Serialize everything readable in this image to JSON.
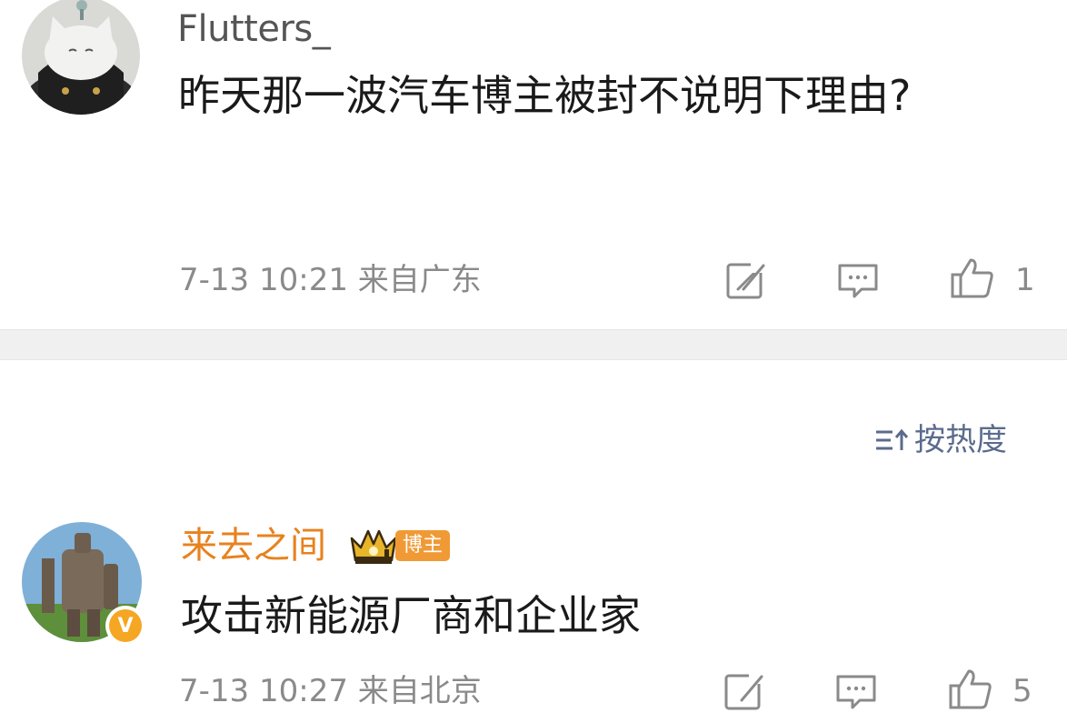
{
  "comments": [
    {
      "username": "Flutters_",
      "text": "昨天那一波汽车博主被封不说明下理由?",
      "timestamp": "7-13 10:21",
      "location": "来自广东",
      "likes": "1",
      "avatar_icon": "white-cat-avatar"
    },
    {
      "username": "来去之间",
      "badge_label": "博主",
      "text": "攻击新能源厂商和企业家",
      "timestamp": "7-13 10:27",
      "location": "来自北京",
      "likes": "5",
      "avatar_icon": "robot-statue-avatar",
      "verified_mark": "V"
    }
  ],
  "sort": {
    "label": "按热度"
  },
  "colors": {
    "author_name": "#e8821e",
    "badge": "#f09a36",
    "verified": "#f5a623",
    "meta": "#8a8a8a",
    "sort_link": "#5a6b8c"
  }
}
